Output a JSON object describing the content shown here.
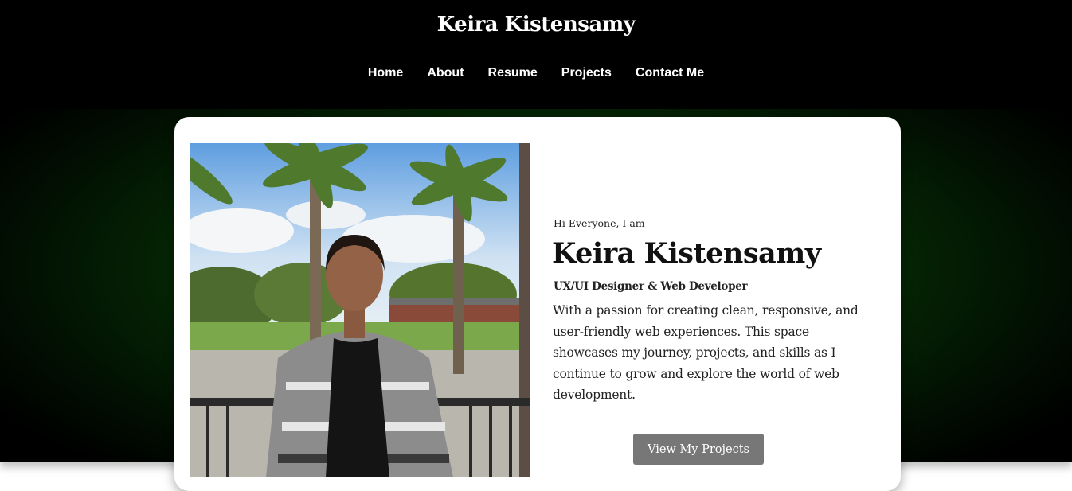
{
  "header": {
    "site_title": "Keira Kistensamy",
    "nav": [
      "Home",
      "About",
      "Resume",
      "Projects",
      "Contact Me"
    ]
  },
  "hero": {
    "greeting": "Hi Everyone, I am",
    "name": "Keira Kistensamy",
    "role": "UX/UI Designer & Web Developer",
    "intro": "With a passion for creating clean, responsive, and user-friendly web experiences. This space showcases my journey, projects, and skills as I continue to grow and explore the world of web development.",
    "cta_label": "View My Projects",
    "photo_icon": "profile-photo"
  },
  "colors": {
    "header_bg": "#000000",
    "hero_glow": "#0b4a0b",
    "card_bg": "#ffffff",
    "button_bg": "#777777"
  }
}
